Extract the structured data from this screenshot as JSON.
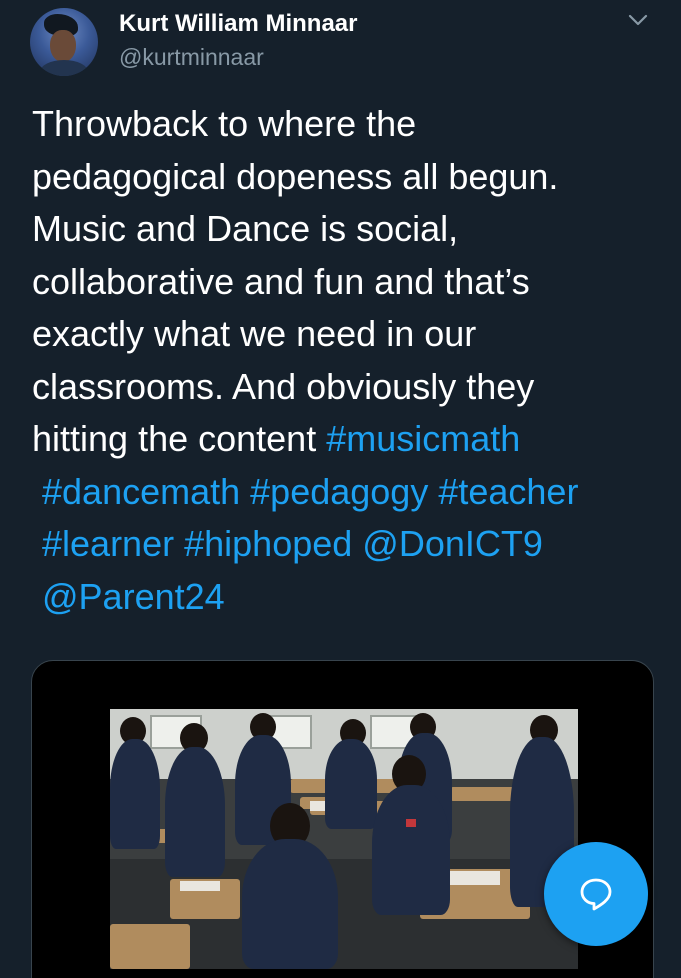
{
  "author": {
    "display_name": "Kurt William Minnaar",
    "handle": "@kurtminnaar"
  },
  "tweet": {
    "lines": [
      "Throwback to where the",
      "pedagogical dopeness all begun.",
      "Music and Dance is social,",
      "collaborative and fun and that’s",
      "exactly what we need in our",
      "classrooms. And obviously they",
      "hitting the content"
    ],
    "tags": {
      "musicmath": "#musicmath",
      "dancemath": "#dancemath",
      "pedagogy": "#pedagogy",
      "teacher": "#teacher",
      "learner": "#learner",
      "hiphoped": "#hiphoped",
      "mention1": "@DonICT9",
      "mention2": "@Parent24"
    }
  },
  "icons": {
    "caret": "chevron-down-icon",
    "reply": "speech-bubble-icon"
  },
  "colors": {
    "background": "#15202b",
    "link": "#1da1f2",
    "secondary_text": "#8899a6",
    "fab": "#1da1f2"
  }
}
